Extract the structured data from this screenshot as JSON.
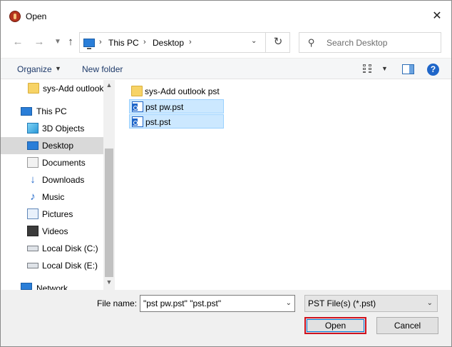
{
  "window": {
    "title": "Open",
    "close_glyph": "✕"
  },
  "nav": {
    "back_glyph": "←",
    "forward_glyph": "→",
    "up_glyph": "↑"
  },
  "address": {
    "crumbs": [
      "This PC",
      "Desktop"
    ],
    "separator": "›",
    "dropdown_glyph": "⌄",
    "refresh_glyph": "↻"
  },
  "search": {
    "placeholder": "Search Desktop",
    "icon_glyph": "⚲"
  },
  "command_bar": {
    "organize_label": "Organize",
    "caret_glyph": "▼",
    "new_folder_label": "New folder",
    "help_glyph": "?"
  },
  "sidebar": {
    "items": [
      {
        "label": "sys-Add outlook",
        "icon": "folder-icon"
      },
      {
        "label": "This PC",
        "icon": "computer-icon"
      },
      {
        "label": "3D Objects",
        "icon": "3d-objects-icon"
      },
      {
        "label": "Desktop",
        "icon": "desktop-icon",
        "selected": true
      },
      {
        "label": "Documents",
        "icon": "documents-icon"
      },
      {
        "label": "Downloads",
        "icon": "downloads-icon",
        "glyph": "↓"
      },
      {
        "label": "Music",
        "icon": "music-icon",
        "glyph": "♪"
      },
      {
        "label": "Pictures",
        "icon": "pictures-icon"
      },
      {
        "label": "Videos",
        "icon": "videos-icon"
      },
      {
        "label": "Local Disk (C:)",
        "icon": "disk-icon"
      },
      {
        "label": "Local Disk (E:)",
        "icon": "disk-icon"
      },
      {
        "label": "Network",
        "icon": "network-icon"
      }
    ],
    "scroll_up_glyph": "▲",
    "scroll_down_glyph": "▼"
  },
  "files": [
    {
      "name": "sys-Add outlook pst",
      "type": "folder",
      "selected": false
    },
    {
      "name": "pst pw.pst",
      "type": "pst",
      "selected": true
    },
    {
      "name": "pst.pst",
      "type": "pst",
      "selected": true
    }
  ],
  "bottom": {
    "file_name_label": "File name:",
    "file_name_value": "\"pst pw.pst\" \"pst.pst\"",
    "file_type_value": "PST File(s) (*.pst)",
    "dropdown_glyph": "⌄",
    "open_label": "Open",
    "cancel_label": "Cancel"
  }
}
